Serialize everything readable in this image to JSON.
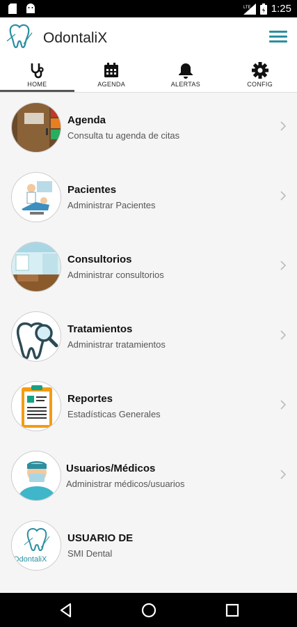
{
  "status_bar": {
    "time": "1:25",
    "icons": [
      "sd-card-icon",
      "android-icon",
      "signal-icon",
      "battery-icon"
    ]
  },
  "app": {
    "title": "OdontaliX",
    "accent": "#2a8fa0"
  },
  "tabs": [
    {
      "label": "HOME",
      "icon": "stethoscope-icon",
      "active": true
    },
    {
      "label": "AGENDA",
      "icon": "calendar-icon",
      "active": false
    },
    {
      "label": "ALERTAS",
      "icon": "bell-icon",
      "active": false
    },
    {
      "label": "CONFIG",
      "icon": "gear-icon",
      "active": false
    }
  ],
  "menu": [
    {
      "title": "Agenda",
      "subtitle": "Consulta tu agenda de citas",
      "icon": "door-icon"
    },
    {
      "title": "Pacientes",
      "subtitle": "Administrar Pacientes",
      "icon": "dental-chair-icon"
    },
    {
      "title": "Consultorios",
      "subtitle": "Administrar consultorios",
      "icon": "clinic-room-icon"
    },
    {
      "title": "Tratamientos",
      "subtitle": "Administrar tratamientos",
      "icon": "tooth-magnifier-icon"
    },
    {
      "title": "Reportes",
      "subtitle": "Estadísticas Generales",
      "icon": "clipboard-report-icon"
    },
    {
      "title": "Usuarios/Médicos",
      "subtitle": "Administrar médicos/usuarios",
      "icon": "doctor-icon"
    },
    {
      "title": "USUARIO DE",
      "subtitle": "SMI Dental",
      "icon": "odontalix-logo-icon",
      "logo_text": "OdontaliX"
    }
  ],
  "nav": [
    "back-icon",
    "home-icon",
    "recents-icon"
  ]
}
